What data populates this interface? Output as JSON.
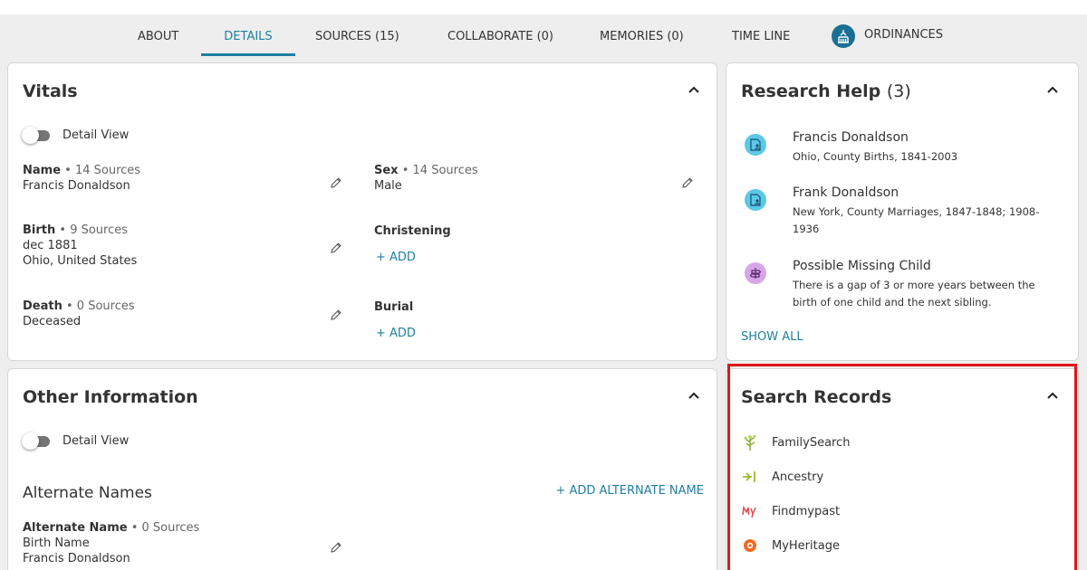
{
  "tabs": [
    {
      "label": "ABOUT",
      "active": false
    },
    {
      "label": "DETAILS",
      "active": true
    },
    {
      "label": "SOURCES (15)",
      "active": false
    },
    {
      "label": "COLLABORATE (0)",
      "active": false
    },
    {
      "label": "MEMORIES (0)",
      "active": false
    },
    {
      "label": "TIME LINE",
      "active": false
    },
    {
      "label": "ORDINANCES",
      "active": false,
      "icon": "temple-icon"
    }
  ],
  "vitals": {
    "title": "Vitals",
    "toggle_label": "Detail View",
    "fields": {
      "name": {
        "label": "Name",
        "sources": "• 14 Sources",
        "value1": "Francis Donaldson"
      },
      "sex": {
        "label": "Sex",
        "sources": "• 14 Sources",
        "value1": "Male"
      },
      "birth": {
        "label": "Birth",
        "sources": "• 9 Sources",
        "value1": "dec 1881",
        "value2": "Ohio, United States"
      },
      "christening": {
        "label": "Christening",
        "add_label": "+ ADD"
      },
      "death": {
        "label": "Death",
        "sources": "• 0 Sources",
        "value1": "Deceased"
      },
      "burial": {
        "label": "Burial",
        "add_label": "+ ADD"
      }
    }
  },
  "other_info": {
    "title": "Other Information",
    "toggle_label": "Detail View",
    "section_title": "Alternate Names",
    "add_label": "+ ADD ALTERNATE NAME",
    "alt_name": {
      "label": "Alternate Name",
      "sources": "• 0 Sources",
      "value1": "Birth Name",
      "value2": "Francis Donaldson"
    }
  },
  "research_help": {
    "title": "Research Help",
    "count": "(3)",
    "items": [
      {
        "title": "Francis Donaldson",
        "desc": "Ohio, County Births, 1841-2003",
        "icon": "record-hint-icon",
        "color": "#5bc8e6"
      },
      {
        "title": "Frank Donaldson",
        "desc": "New York, County Marriages, 1847-1848; 1908-1936",
        "icon": "record-hint-icon",
        "color": "#5bc8e6"
      },
      {
        "title": "Possible Missing Child",
        "desc": "There is a gap of 3 or more years between the birth of one child and the next sibling.",
        "icon": "research-suggestion-icon",
        "color": "#d7a6e8"
      }
    ],
    "show_all": "SHOW ALL"
  },
  "search_records": {
    "title": "Search Records",
    "items": [
      {
        "name": "FamilySearch",
        "icon": "familysearch-tree-icon",
        "color": "#8db33a"
      },
      {
        "name": "Ancestry",
        "icon": "ancestry-leaf-icon",
        "color": "#9cbe30"
      },
      {
        "name": "Findmypast",
        "icon": "findmypast-logo-icon",
        "color": "#e5484d"
      },
      {
        "name": "MyHeritage",
        "icon": "myheritage-logo-icon",
        "color": "#f26a21"
      }
    ]
  },
  "colors": {
    "accent": "#1f7fa1",
    "highlight": "#e0151b"
  }
}
